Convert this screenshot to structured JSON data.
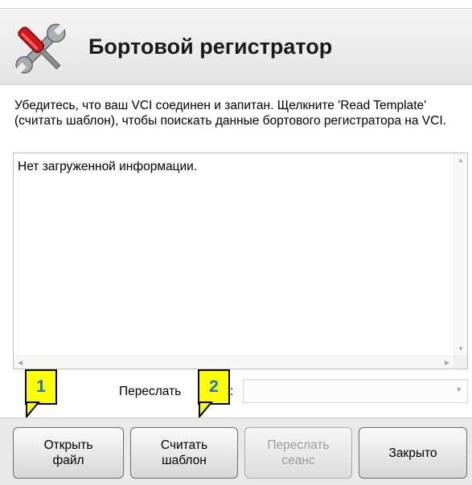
{
  "header": {
    "title": "Бортовой регистратор",
    "icon": "tools-icon"
  },
  "instructions": "Убедитесь, что ваш VCI соединен и запитан. Щелкните 'Read Template' (считать шаблон), чтобы поискать данные бортового регистратора на VCI.",
  "log": {
    "text": "Нет загруженной информации."
  },
  "forward": {
    "label": "Переслать",
    "colon": ":",
    "selected": ""
  },
  "buttons": {
    "open": "Открыть\nфайл",
    "read": "Считать\nшаблон",
    "forward_session": "Переслать\nсеанс",
    "close": "Закрыто"
  },
  "callouts": [
    "1",
    "2"
  ],
  "colors": {
    "callout_fill": "#ffff00",
    "callout_number": "#1874d6"
  }
}
